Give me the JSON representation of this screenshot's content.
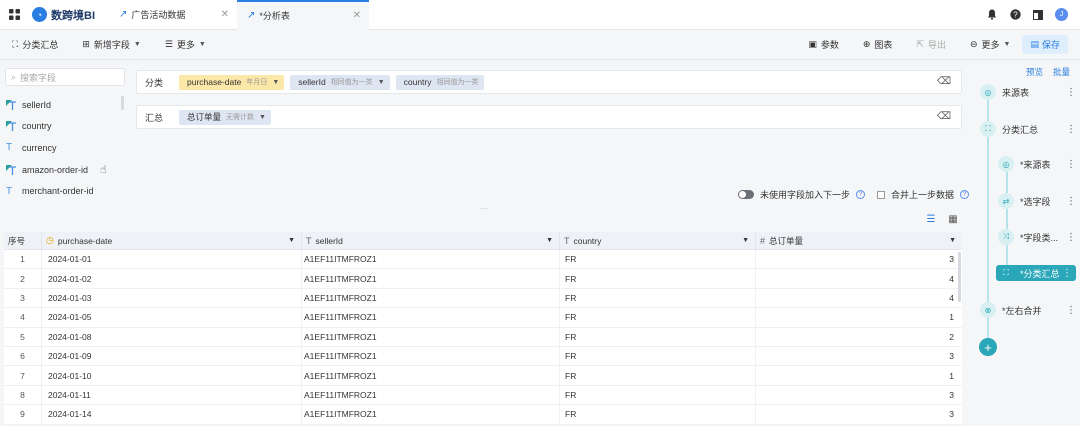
{
  "app": {
    "logo_text": "数跨境BI"
  },
  "tabs": [
    {
      "label": "广告活动数据"
    },
    {
      "label": "*分析表"
    }
  ],
  "topbar": {
    "avatar": "J"
  },
  "toolbar": {
    "left": [
      {
        "label": "分类汇总"
      },
      {
        "label": "新增字段"
      },
      {
        "label": "更多"
      }
    ],
    "right": [
      {
        "label": "参数"
      },
      {
        "label": "图表"
      },
      {
        "label": "导出"
      },
      {
        "label": "更多"
      },
      {
        "label": "保存"
      }
    ]
  },
  "search": {
    "placeholder": "搜索字段"
  },
  "fields": [
    {
      "name": "sellerId",
      "icon": "geo"
    },
    {
      "name": "country",
      "icon": "geo"
    },
    {
      "name": "currency",
      "icon": "text"
    },
    {
      "name": "amazon-order-id",
      "icon": "geo"
    },
    {
      "name": "merchant-order-id",
      "icon": "text"
    }
  ],
  "config": {
    "group_label": "分类",
    "group_pills": [
      {
        "name": "purchase-date",
        "sub": "年月日",
        "color": "#fbe7a8"
      },
      {
        "name": "sellerId",
        "sub": "相同值为一类",
        "color": "#dfe6f3"
      },
      {
        "name": "country",
        "sub": "相同值为一类",
        "color": "#dfe6f3"
      }
    ],
    "summary_label": "汇总",
    "summary_pills": [
      {
        "name": "总订单量",
        "sub": "无需计数",
        "color": "#dfe6f3"
      }
    ]
  },
  "options": {
    "unused_label": "未使用字段加入下一步",
    "merge_label": "合并上一步数据"
  },
  "table": {
    "columns": [
      "序号",
      "purchase-date",
      "sellerId",
      "country",
      "总订单量"
    ],
    "rows": [
      [
        "1",
        "2024-01-01",
        "A1EF11ITMFROZ1",
        "FR",
        "3"
      ],
      [
        "2",
        "2024-01-02",
        "A1EF11ITMFROZ1",
        "FR",
        "4"
      ],
      [
        "3",
        "2024-01-03",
        "A1EF11ITMFROZ1",
        "FR",
        "4"
      ],
      [
        "4",
        "2024-01-05",
        "A1EF11ITMFROZ1",
        "FR",
        "1"
      ],
      [
        "5",
        "2024-01-08",
        "A1EF11ITMFROZ1",
        "FR",
        "2"
      ],
      [
        "6",
        "2024-01-09",
        "A1EF11ITMFROZ1",
        "FR",
        "3"
      ],
      [
        "7",
        "2024-01-10",
        "A1EF11ITMFROZ1",
        "FR",
        "1"
      ],
      [
        "8",
        "2024-01-11",
        "A1EF11ITMFROZ1",
        "FR",
        "3"
      ],
      [
        "9",
        "2024-01-14",
        "A1EF11ITMFROZ1",
        "FR",
        "3"
      ]
    ]
  },
  "flow": {
    "preview": "预览",
    "batch": "批量",
    "nodes": [
      {
        "label": "来源表"
      },
      {
        "label": "分类汇总"
      },
      {
        "label": "*来源表"
      },
      {
        "label": "*选字段"
      },
      {
        "label": "*字段类..."
      },
      {
        "label": "*分类汇总"
      },
      {
        "label": "*左右合并"
      }
    ]
  },
  "colors": {
    "accent": "#2a7de1",
    "flow_accent": "#2aa7b8"
  }
}
